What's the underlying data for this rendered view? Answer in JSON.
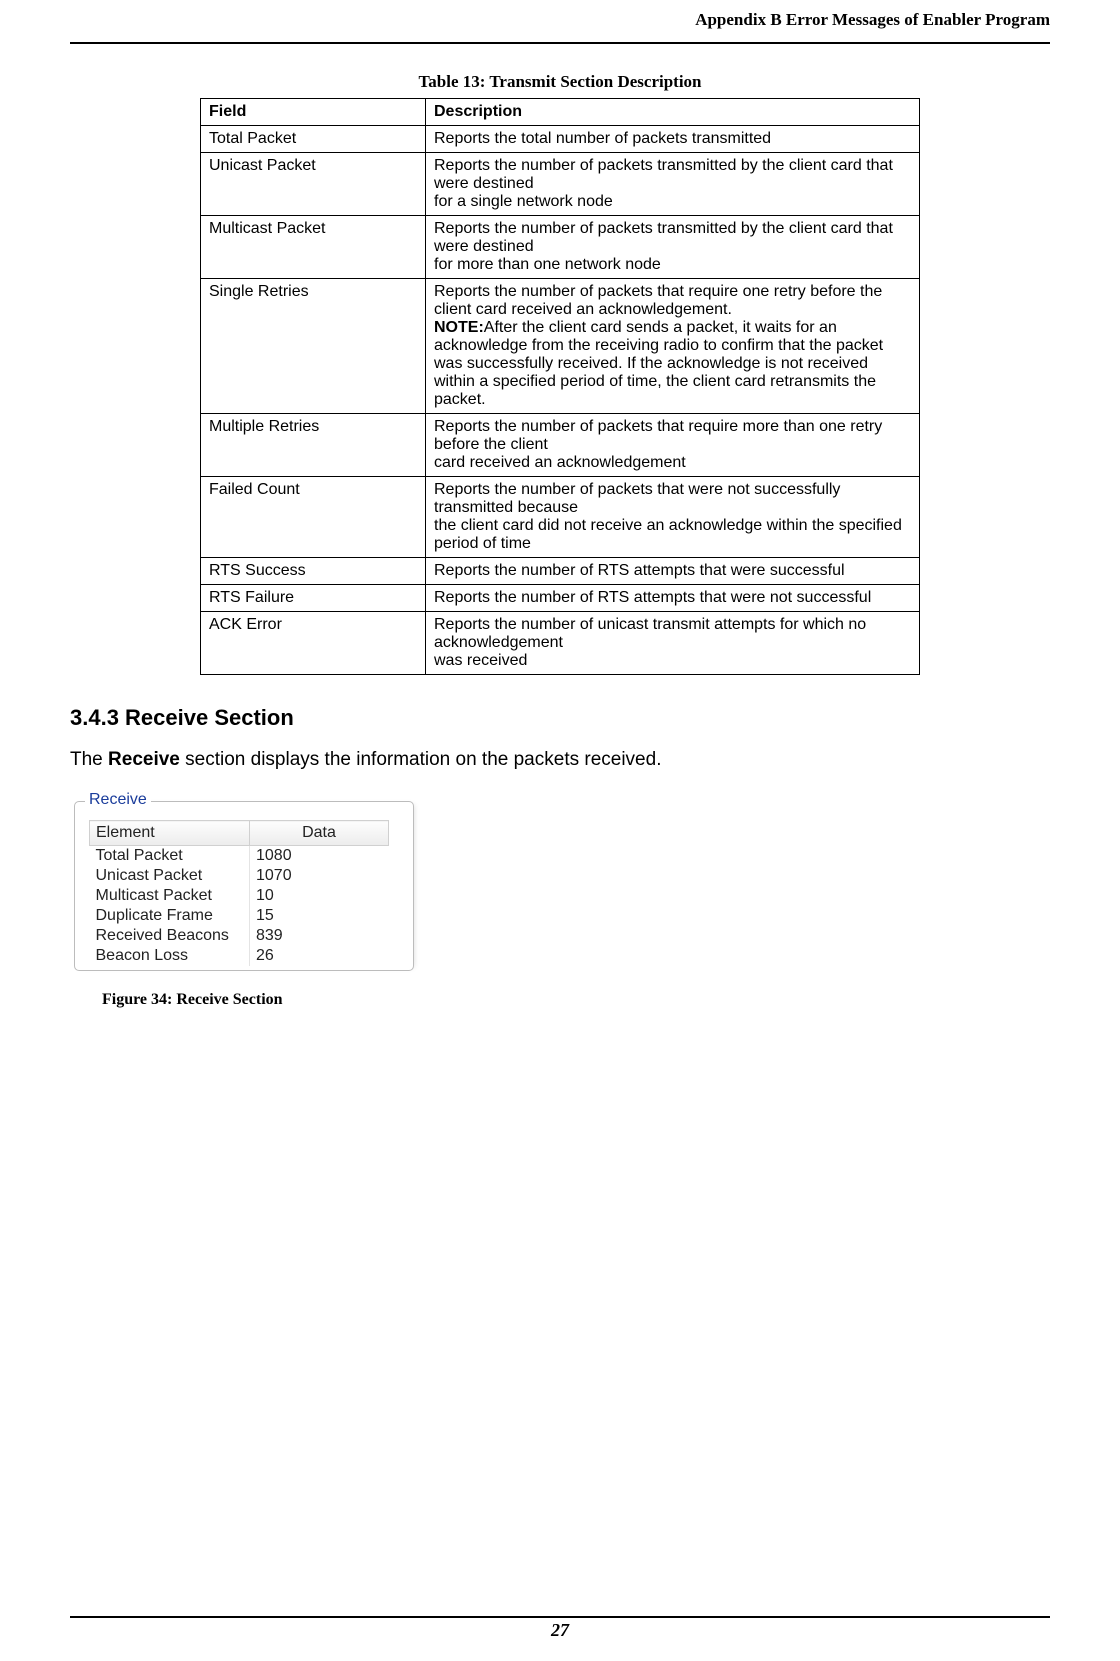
{
  "header": {
    "title": "Appendix B Error Messages of Enabler Program"
  },
  "table13": {
    "caption": "Table 13: Transmit Section Description",
    "col_field": "Field",
    "col_desc": "Description",
    "rows": [
      {
        "field": "Total Packet",
        "desc": "Reports the total number of packets transmitted"
      },
      {
        "field": "Unicast Packet",
        "desc": "Reports the number of packets transmitted by the client card that were destined\nfor a single network node"
      },
      {
        "field": "Multicast Packet",
        "desc": "Reports the number of packets transmitted by the client card that were destined\nfor more than one network node"
      },
      {
        "field": "Single Retries",
        "desc_line1": "Reports the number of packets that require one retry before the client card received an acknowledgement.",
        "note_label": "NOTE:",
        "note_text": "After the client card sends a packet, it waits for an acknowledge from the receiving radio to confirm that the packet was successfully received. If the acknowledge is not received within a specified period of time, the client card retransmits the packet."
      },
      {
        "field": "Multiple Retries",
        "desc": "Reports the number of packets that require more than one retry before the client\ncard received an acknowledgement"
      },
      {
        "field": "Failed Count",
        "desc": "Reports the number of packets that were not successfully transmitted because\nthe client card did not receive an acknowledge within the specified period of time"
      },
      {
        "field": "RTS Success",
        "desc": "Reports the number of RTS attempts that were successful"
      },
      {
        "field": "RTS Failure",
        "desc": "Reports the number of RTS attempts that were not successful"
      },
      {
        "field": "ACK Error",
        "desc": "Reports the number of unicast transmit attempts for which no acknowledgement\nwas received"
      }
    ]
  },
  "section": {
    "heading": "3.4.3 Receive Section",
    "para_pre": "The ",
    "para_bold": "Receive",
    "para_post": " section displays the information on the packets received."
  },
  "receive_fig": {
    "legend": "Receive",
    "col_element": "Element",
    "col_data": "Data",
    "rows": [
      {
        "element": "Total Packet",
        "data": "1080"
      },
      {
        "element": "Unicast Packet",
        "data": "1070"
      },
      {
        "element": "Multicast Packet",
        "data": "10"
      },
      {
        "element": "Duplicate Frame",
        "data": "15"
      },
      {
        "element": "Received Beacons",
        "data": "839"
      },
      {
        "element": "Beacon Loss",
        "data": "26"
      }
    ],
    "caption": "Figure 34: Receive Section"
  },
  "footer": {
    "page_number": "27"
  }
}
